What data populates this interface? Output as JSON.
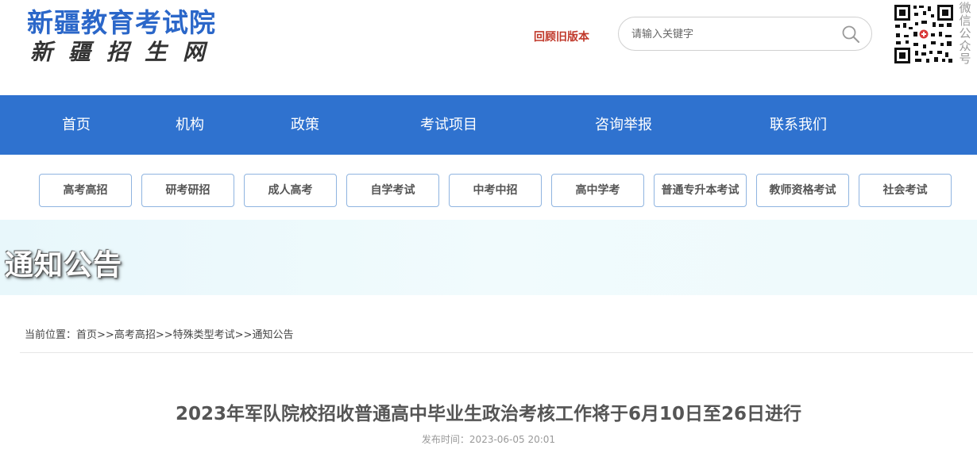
{
  "header": {
    "logo_title": "新疆教育考试院",
    "logo_subtitle": "新疆招生网",
    "old_version_link": "回顾旧版本",
    "search_placeholder": "请输入关键字",
    "qr_label": "微信公众号"
  },
  "nav": {
    "items": [
      "首页",
      "机构",
      "政策",
      "考试项目",
      "咨询举报",
      "联系我们"
    ]
  },
  "categories": [
    "高考高招",
    "研考研招",
    "成人高考",
    "自学考试",
    "中考中招",
    "高中学考",
    "普通专升本考试",
    "教师资格考试",
    "社会考试"
  ],
  "banner": {
    "title": "通知公告"
  },
  "breadcrumb": {
    "prefix": "当前位置：",
    "items": [
      "首页",
      "高考高招",
      "特殊类型考试",
      "通知公告"
    ],
    "separator": ">>"
  },
  "article": {
    "title": "2023年军队院校招收普通高中毕业生政治考核工作将于6月10日至26日进行",
    "published": "发布时间：2023-06-05 20:01"
  },
  "colors": {
    "brand_blue": "#2f72cf",
    "logo_blue": "#2b67c9",
    "link_red": "#c0392b"
  }
}
